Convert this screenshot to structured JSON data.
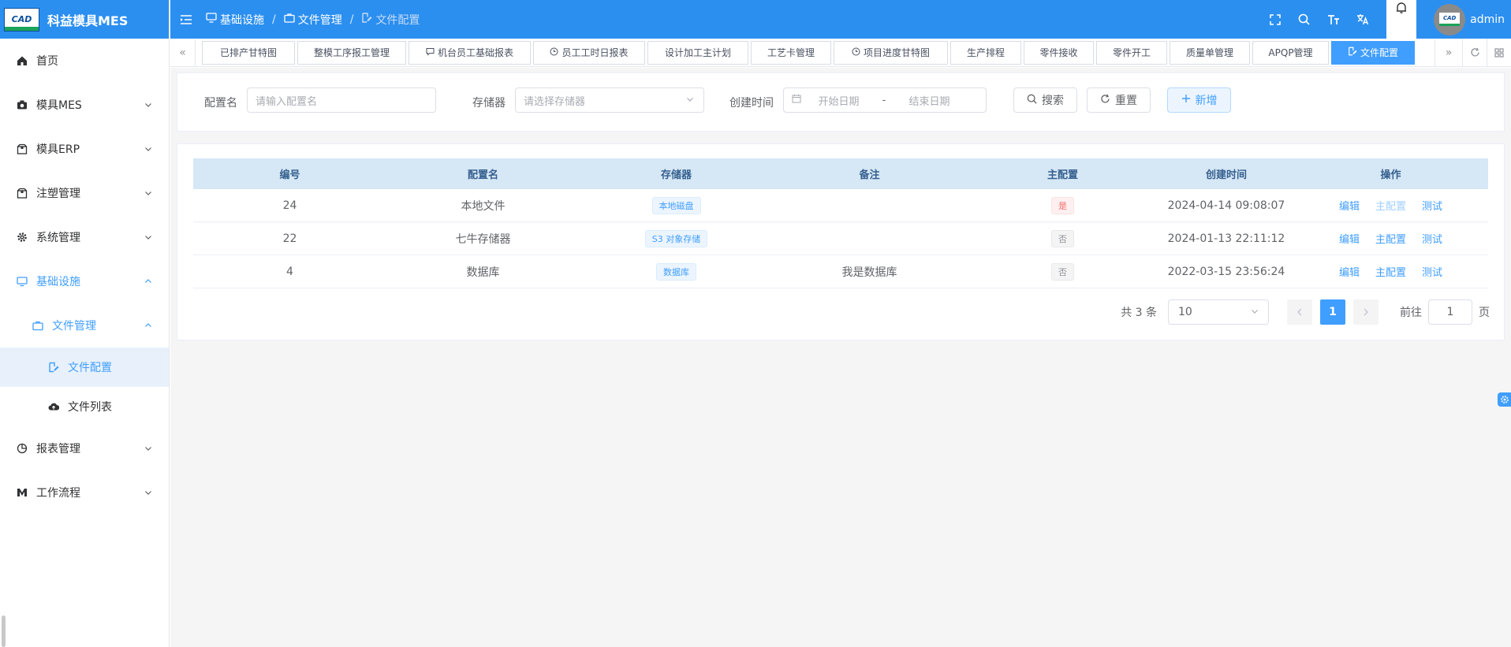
{
  "app": {
    "title": "科益模具MES",
    "logo_text": "CAD"
  },
  "sidebar": {
    "items": [
      {
        "label": "首页",
        "icon": "home-icon"
      },
      {
        "label": "模具MES",
        "icon": "camera-icon"
      },
      {
        "label": "模具ERP",
        "icon": "box-icon"
      },
      {
        "label": "注塑管理",
        "icon": "box-icon"
      },
      {
        "label": "系统管理",
        "icon": "gear-icon"
      },
      {
        "label": "基础设施",
        "icon": "monitor-icon"
      },
      {
        "label": "文件管理",
        "icon": "briefcase-icon"
      },
      {
        "label": "文件配置",
        "icon": "edit-icon"
      },
      {
        "label": "文件列表",
        "icon": "cloud-upload-icon"
      },
      {
        "label": "报表管理",
        "icon": "pie-chart-icon"
      },
      {
        "label": "工作流程",
        "icon": "workflow-icon"
      }
    ]
  },
  "header": {
    "breadcrumb": [
      "基础设施",
      "文件管理",
      "文件配置"
    ],
    "username": "admin",
    "avatar_text": "CAD"
  },
  "tabs": {
    "items": [
      {
        "label": "已排产甘特图",
        "icon": ""
      },
      {
        "label": "整模工序报工管理",
        "icon": ""
      },
      {
        "label": "机台员工基础报表",
        "icon": "chat-icon"
      },
      {
        "label": "员工工时日报表",
        "icon": "clock-icon"
      },
      {
        "label": "设计加工主计划",
        "icon": ""
      },
      {
        "label": "工艺卡管理",
        "icon": ""
      },
      {
        "label": "项目进度甘特图",
        "icon": "clock-icon"
      },
      {
        "label": "生产排程",
        "icon": ""
      },
      {
        "label": "零件接收",
        "icon": ""
      },
      {
        "label": "零件开工",
        "icon": ""
      },
      {
        "label": "质量单管理",
        "icon": ""
      },
      {
        "label": "APQP管理",
        "icon": ""
      },
      {
        "label": "文件配置",
        "icon": "edit-icon",
        "active": true
      }
    ]
  },
  "search": {
    "name_label": "配置名",
    "name_placeholder": "请输入配置名",
    "storage_label": "存储器",
    "storage_placeholder": "请选择存储器",
    "time_label": "创建时间",
    "start_placeholder": "开始日期",
    "range_sep": "-",
    "end_placeholder": "结束日期",
    "search_btn": "搜索",
    "reset_btn": "重置",
    "add_btn": "新增"
  },
  "table": {
    "columns": [
      "编号",
      "配置名",
      "存储器",
      "备注",
      "主配置",
      "创建时间",
      "操作"
    ],
    "rows": [
      {
        "id": "24",
        "name": "本地文件",
        "storage": "本地磁盘",
        "remark": "",
        "master": "是",
        "master_type": "danger",
        "created": "2024-04-14 09:08:07",
        "actions": [
          "编辑",
          "主配置",
          "测试"
        ],
        "master_disabled": true
      },
      {
        "id": "22",
        "name": "七牛存储器",
        "storage": "S3 对象存储",
        "remark": "",
        "master": "否",
        "master_type": "info",
        "created": "2024-01-13 22:11:12",
        "actions": [
          "编辑",
          "主配置",
          "测试"
        ],
        "master_disabled": false
      },
      {
        "id": "4",
        "name": "数据库",
        "storage": "数据库",
        "remark": "我是数据库",
        "master": "否",
        "master_type": "info",
        "created": "2022-03-15 23:56:24",
        "actions": [
          "编辑",
          "主配置",
          "测试"
        ],
        "master_disabled": false
      }
    ]
  },
  "pagination": {
    "total_text": "共 3 条",
    "page_size": "10",
    "current_page": "1",
    "goto_label": "前往",
    "goto_value": "1",
    "page_suffix": "页"
  },
  "colors": {
    "header": "#2b8ff0",
    "accent": "#409eff"
  }
}
